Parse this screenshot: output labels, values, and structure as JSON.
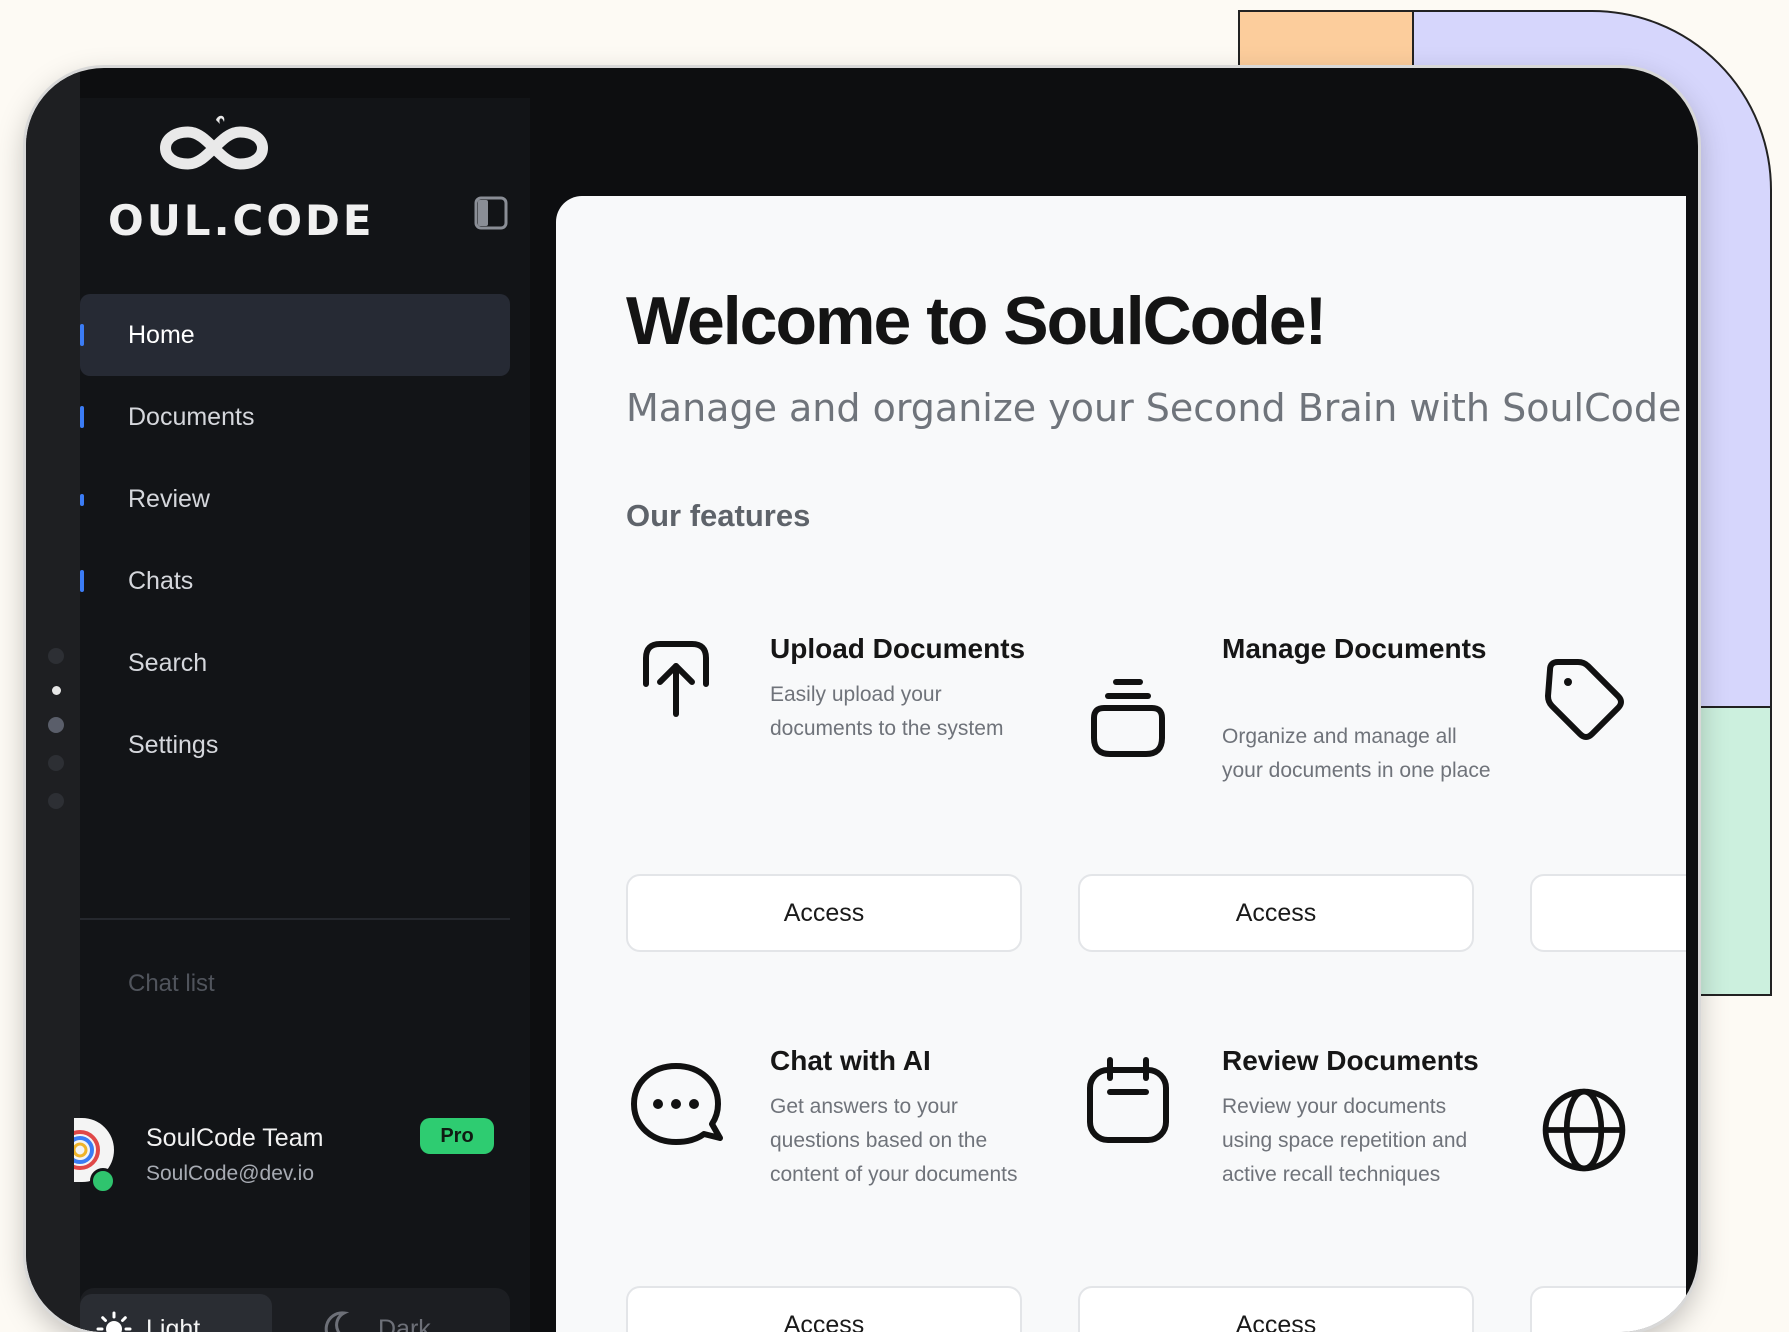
{
  "app": {
    "logo_text": "OUL.CODE",
    "panel_toggle_icon": "sidebar-panel-icon"
  },
  "sidebar": {
    "items": [
      {
        "label": "Home",
        "active": true
      },
      {
        "label": "Documents",
        "active": false
      },
      {
        "label": "Review",
        "active": false
      },
      {
        "label": "Chats",
        "active": false
      },
      {
        "label": "Search",
        "active": false
      },
      {
        "label": "Settings",
        "active": false
      }
    ],
    "chat_list_label": "Chat list"
  },
  "user": {
    "name": "SoulCode Team",
    "email": "SoulCode@dev.io",
    "plan_badge": "Pro",
    "status_color": "#2fc46e"
  },
  "theme": {
    "light_label": "Light",
    "dark_label": "Dark",
    "light_icon": "sun-icon",
    "dark_icon": "moon-icon",
    "selected": "Light"
  },
  "main": {
    "title": "Welcome to SoulCode!",
    "subtitle": "Manage and organize your Second Brain with SoulCode",
    "features_heading": "Our features",
    "features": [
      {
        "title": "Upload Documents",
        "description": "Easily upload your documents to the system",
        "icon": "upload-icon",
        "button": "Access"
      },
      {
        "title": "Manage Documents",
        "description": "Organize and manage all your documents in one place",
        "icon": "stack-icon",
        "button": "Access"
      },
      {
        "title": "Chat with AI",
        "description": "Get answers to your questions based on the content of your documents",
        "icon": "chat-bubble-icon",
        "button": "Access"
      },
      {
        "title": "Review Documents",
        "description": "Review your documents using space repetition and active recall techniques",
        "icon": "calendar-icon",
        "button": "Access"
      }
    ],
    "partial_icons": [
      "tag-icon",
      "globe-icon"
    ]
  },
  "colors": {
    "accent": "#3b7cf5",
    "pro_badge": "#2ecc71",
    "sidebar_bg": "#121417",
    "content_bg": "#f8f9fa"
  }
}
